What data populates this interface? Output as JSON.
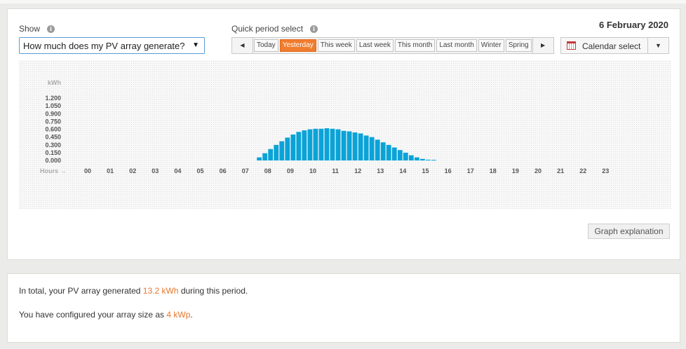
{
  "show": {
    "label": "Show",
    "selected": "How much does my PV array generate?"
  },
  "quick_period": {
    "label": "Quick period select",
    "prev_icon": "chevron-left-icon",
    "next_icon": "chevron-right-icon",
    "buttons": [
      "Today",
      "Yesterday",
      "This week",
      "Last week",
      "This month",
      "Last month",
      "Winter",
      "Spring"
    ],
    "active": "Yesterday"
  },
  "calendar": {
    "label": "Calendar select",
    "icon": "calendar-icon"
  },
  "date_title": "6 February 2020",
  "graph_explanation_label": "Graph explanation",
  "summary": {
    "line1_prefix": "In total, your PV array generated",
    "line1_value": "13.2 kWh",
    "line1_suffix": "during this period.",
    "line2_prefix": "You have configured your array size as",
    "line2_value": "4 kWp",
    "line2_suffix": "."
  },
  "colors": {
    "bar": "#0aa3d8",
    "accent": "#f07c2e"
  },
  "chart_data": {
    "type": "bar",
    "ylabel": "kWh",
    "xlabel": "Hours →",
    "y_ticks": [
      "0.000",
      "0.150",
      "0.300",
      "0.450",
      "0.600",
      "0.750",
      "0.900",
      "1.050",
      "1.200"
    ],
    "ylim": [
      0,
      1.35
    ],
    "x_ticks": [
      "00",
      "01",
      "02",
      "03",
      "04",
      "05",
      "06",
      "07",
      "08",
      "09",
      "10",
      "11",
      "12",
      "13",
      "14",
      "15",
      "16",
      "17",
      "18",
      "19",
      "20",
      "21",
      "22",
      "23"
    ],
    "bar_step_hours": 0.25,
    "first_bar_time": 7.75,
    "values": [
      0.06,
      0.14,
      0.22,
      0.3,
      0.37,
      0.44,
      0.5,
      0.55,
      0.58,
      0.6,
      0.61,
      0.61,
      0.62,
      0.61,
      0.6,
      0.57,
      0.56,
      0.54,
      0.52,
      0.48,
      0.45,
      0.4,
      0.35,
      0.3,
      0.25,
      0.2,
      0.15,
      0.1,
      0.06,
      0.03,
      0.015,
      0.005
    ]
  }
}
